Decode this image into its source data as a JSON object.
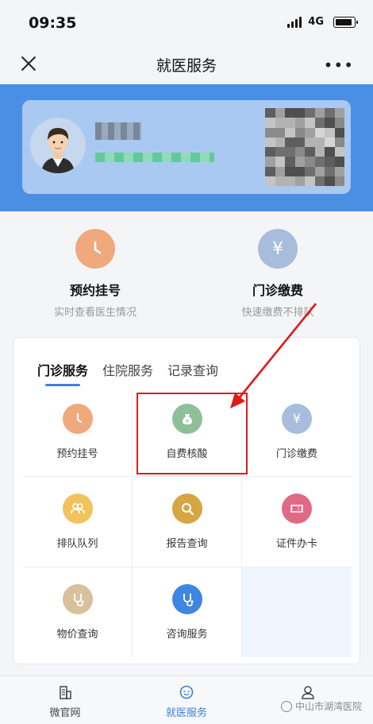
{
  "status_bar": {
    "time": "09:35",
    "network": "4G"
  },
  "nav": {
    "title": "就医服务"
  },
  "quick_actions": [
    {
      "title": "预约挂号",
      "subtitle": "实时查看医生情况",
      "icon": "clock-icon",
      "color": "#efa97c"
    },
    {
      "title": "门诊缴费",
      "subtitle": "快速缴费不排队",
      "icon": "yen-icon",
      "color": "#a7bddb"
    }
  ],
  "service_tabs": [
    {
      "label": "门诊服务",
      "active": true
    },
    {
      "label": "住院服务",
      "active": false
    },
    {
      "label": "记录查询",
      "active": false
    }
  ],
  "services": [
    {
      "label": "预约挂号",
      "icon": "clock-icon",
      "color": "#efa97c"
    },
    {
      "label": "自费核酸",
      "icon": "money-bag-icon",
      "color": "#8fbf99"
    },
    {
      "label": "门诊缴费",
      "icon": "yen-icon",
      "color": "#a7bddb"
    },
    {
      "label": "排队队列",
      "icon": "people-icon",
      "color": "#f2c25b"
    },
    {
      "label": "报告查询",
      "icon": "search-icon",
      "color": "#d6a544"
    },
    {
      "label": "证件办卡",
      "icon": "ticket-icon",
      "color": "#e06a86"
    },
    {
      "label": "物价查询",
      "icon": "stethoscope-icon",
      "color": "#d8c19c"
    },
    {
      "label": "咨询服务",
      "icon": "stethoscope-icon",
      "color": "#3f86e0"
    }
  ],
  "tabbar": [
    {
      "label": "微官网",
      "icon": "building-icon",
      "active": false
    },
    {
      "label": "就医服务",
      "icon": "chat-icon",
      "active": true
    },
    {
      "label": "",
      "icon": "user-icon",
      "active": false
    }
  ],
  "watermark": {
    "text": "中山市湖湾医院"
  }
}
